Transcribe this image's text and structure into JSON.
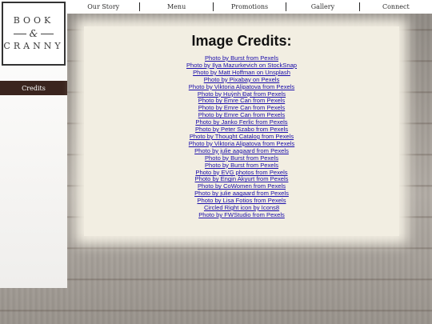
{
  "nav": {
    "items": [
      {
        "label": "Our Story"
      },
      {
        "label": "Menu"
      },
      {
        "label": "Promotions"
      },
      {
        "label": "Gallery"
      },
      {
        "label": "Connect"
      }
    ]
  },
  "logo": {
    "line1": "BOOK",
    "amp": "&",
    "line2": "CRANNY"
  },
  "sidebar": {
    "active_item": "Credits"
  },
  "main": {
    "title": "Image Credits:",
    "credits": [
      "Photo by Burst from Pexels",
      "Photo by Ilya Mazurkevich on StockSnap",
      "Photo by Matt Hoffman on Unsplash",
      "Photo by Pixabay on Pexels",
      "Photo by Viktoria Alipatova from Pexels",
      "Photo by Huỳnh Đạt from Pexels",
      "Photo by Emre Can from Pexels",
      "Photo by Emre Can from Pexels",
      "Photo by Emre Can from Pexels",
      "Photo by Janko Ferlic from Pexels",
      "Photo by Peter Szabo from Pexels",
      "Photo by Thought Catalog from Pexels",
      "Photo by Viktoria Alipatova from Pexels",
      "Photo by julie aagaard from Pexels",
      "Photo by Burst from Pexels",
      "Photo by Burst from Pexels",
      "Photo by EVG photos from Pexels",
      "Photo by Engin Akyurt from Pexels",
      "Photo by CoWomen from Pexels",
      "Photo by julie aagaard from Pexels",
      "Photo by Lisa Fotios from Pexels",
      "Circled Right icon by Icons8",
      "Photo by FWStudio from Pexels"
    ]
  },
  "colors": {
    "sidebar_active_bg": "#3a241e",
    "link": "#1a0dab",
    "panel_bg": "#f2eee2"
  }
}
